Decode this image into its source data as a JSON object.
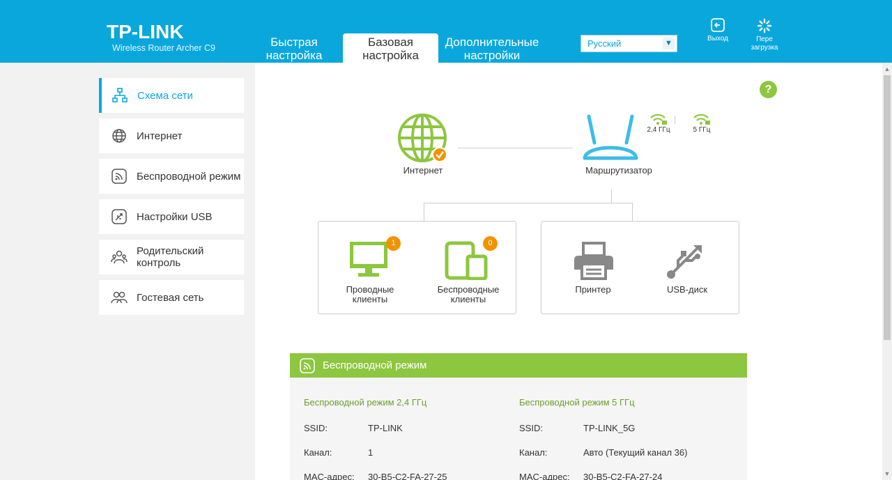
{
  "header": {
    "logo": "TP-LINK",
    "model": "Wireless Router Archer C9",
    "tabs": [
      {
        "line1": "Быстрая",
        "line2": "настройка"
      },
      {
        "line1": "Базовая",
        "line2": "настройка"
      },
      {
        "line1": "Дополнительные",
        "line2": "настройки"
      }
    ],
    "language": "Русский",
    "logout_label": "Выход",
    "reboot_label_1": "Пере",
    "reboot_label_2": "загрузка"
  },
  "sidebar": {
    "items": [
      {
        "label": "Схема сети",
        "icon": "network-map-icon",
        "active": true
      },
      {
        "label": "Интернет",
        "icon": "globe-icon"
      },
      {
        "label": "Беспроводной режим",
        "icon": "wireless-icon"
      },
      {
        "label": "Настройки USB",
        "icon": "usb-icon"
      },
      {
        "label": "Родительский контроль",
        "icon": "parental-control-icon"
      },
      {
        "label": "Гостевая сеть",
        "icon": "guest-network-icon"
      }
    ]
  },
  "map": {
    "internet_label": "Интернет",
    "router_label": "Маршрутизатор",
    "band_24": "2,4 ГГц",
    "band_5": "5 ГГц",
    "wired_clients": {
      "line1": "Проводные",
      "line2": "клиенты",
      "count": "1"
    },
    "wireless_clients": {
      "line1": "Беспроводные",
      "line2": "клиенты",
      "count": "0"
    },
    "printer_label": "Принтер",
    "usb_disk_label": "USB-диск",
    "help": "?"
  },
  "wireless_panel": {
    "title": "Беспроводной режим",
    "band24": {
      "title": "Беспроводной режим 2,4 ГГц",
      "ssid_key": "SSID:",
      "ssid": "TP-LINK",
      "channel_key": "Канал:",
      "channel": "1",
      "mac_key": "MAC-адрес:",
      "mac": "30-B5-C2-FA-27-25"
    },
    "band5": {
      "title": "Беспроводной режим 5 ГГц",
      "ssid_key": "SSID:",
      "ssid": "TP-LINK_5G",
      "channel_key": "Канал:",
      "channel": "Авто (Текущий канал 36)",
      "mac_key": "MAC-адрес:",
      "mac": "30-B5-C2-FA-27-24"
    }
  },
  "colors": {
    "brand_blue": "#0aa7dc",
    "green": "#8dc63f",
    "orange": "#f39200",
    "gray_icon": "#888888"
  }
}
